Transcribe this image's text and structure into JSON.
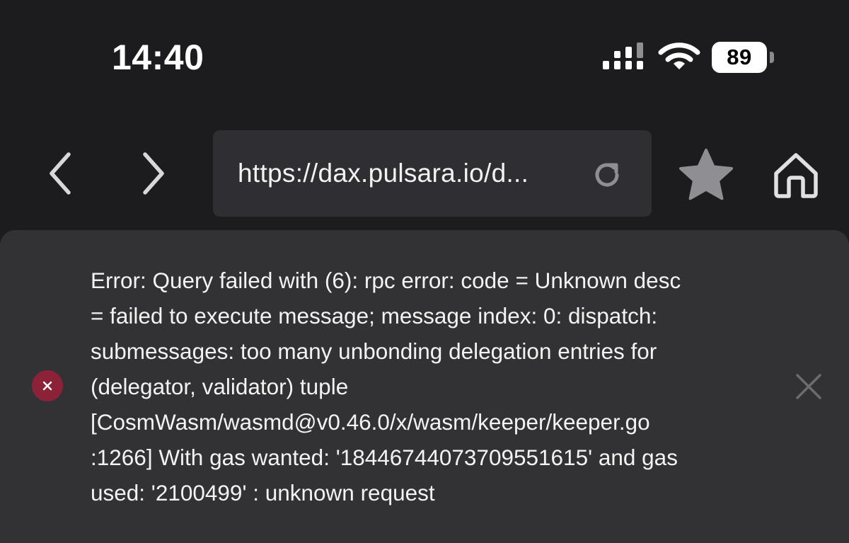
{
  "status_bar": {
    "time": "14:40",
    "battery_level": "89",
    "icons": [
      "cellular-signal-icon",
      "wifi-icon",
      "battery-icon"
    ]
  },
  "toolbar": {
    "back_icon": "chevron-left-icon",
    "forward_icon": "chevron-right-icon",
    "url": "https://dax.pulsara.io/d...",
    "reload_icon": "reload-icon",
    "star_icon": "star-icon",
    "home_icon": "home-icon"
  },
  "error_toast": {
    "icon": "error-x-icon",
    "lines": [
      "Error: Query failed with (6): rpc error: code = Unknown desc",
      "= failed to execute message; message index: 0: dispatch:",
      "submessages: too many unbonding delegation entries for",
      "(delegator, validator) tuple",
      "[CosmWasm/wasmd@v0.46.0/x/wasm/keeper/keeper.go",
      ":1266] With gas wanted: '18446744073709551615' and gas",
      "used: '2100499' : unknown request"
    ],
    "close_icon": "close-icon"
  },
  "colors": {
    "background": "#1c1c1e",
    "url_bar": "#2f2f33",
    "panel": "#323234",
    "error_accent": "#8c2237",
    "icon_gray": "#8e8e93",
    "text": "#f3f3f3"
  }
}
